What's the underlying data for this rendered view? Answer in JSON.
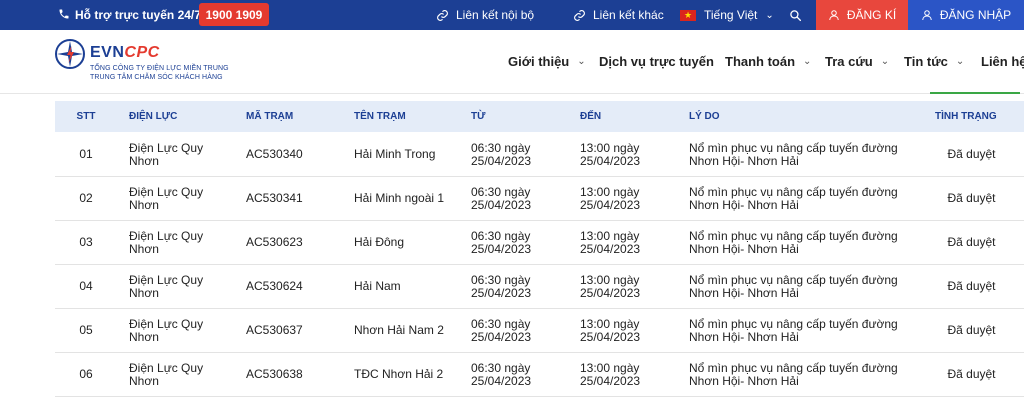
{
  "topbar": {
    "hotline_label": "Hỗ trợ trực tuyến 24/7:",
    "hotline_number": "1900 1909",
    "links": [
      {
        "label": "Liên kết nội bộ"
      },
      {
        "label": "Liên kết khác"
      }
    ],
    "language": "Tiếng Việt",
    "register_label": "ĐĂNG KÍ",
    "login_label": "ĐĂNG NHẬP"
  },
  "header": {
    "brand_evn": "EVN",
    "brand_cpc": "CPC",
    "sub1": "TỔNG CÔNG TY ĐIỆN LỰC MIỀN TRUNG",
    "sub2": "TRUNG TÂM CHĂM SÓC KHÁCH HÀNG",
    "nav": [
      {
        "label": "Giới thiệu"
      },
      {
        "label": "Dịch vụ trực tuyến"
      },
      {
        "label": "Thanh toán"
      },
      {
        "label": "Tra cứu"
      },
      {
        "label": "Tin tức"
      },
      {
        "label": "Liên hệ"
      }
    ]
  },
  "table": {
    "headers": [
      "STT",
      "ĐIỆN LỰC",
      "MÃ TRẠM",
      "TÊN TRẠM",
      "TỪ",
      "ĐẾN",
      "LÝ DO",
      "TÌNH TRẠNG"
    ],
    "rows": [
      [
        "01",
        "Điện Lực Quy Nhơn",
        "AC530340",
        "Hải Minh Trong",
        "06:30 ngày 25/04/2023",
        "13:00 ngày 25/04/2023",
        "Nổ mìn phục vụ nâng cấp tuyến đường Nhơn Hội- Nhơn Hải",
        "Đã duyệt"
      ],
      [
        "02",
        "Điện Lực Quy Nhơn",
        "AC530341",
        "Hải Minh ngoài 1",
        "06:30 ngày 25/04/2023",
        "13:00 ngày 25/04/2023",
        "Nổ mìn phục vụ nâng cấp tuyến đường Nhơn Hội- Nhơn Hải",
        "Đã duyệt"
      ],
      [
        "03",
        "Điện Lực Quy Nhơn",
        "AC530623",
        "Hải Đông",
        "06:30 ngày 25/04/2023",
        "13:00 ngày 25/04/2023",
        "Nổ mìn phục vụ nâng cấp tuyến đường Nhơn Hội- Nhơn Hải",
        "Đã duyệt"
      ],
      [
        "04",
        "Điện Lực Quy Nhơn",
        "AC530624",
        "Hải Nam",
        "06:30 ngày 25/04/2023",
        "13:00 ngày 25/04/2023",
        "Nổ mìn phục vụ nâng cấp tuyến đường Nhơn Hội- Nhơn Hải",
        "Đã duyệt"
      ],
      [
        "05",
        "Điện Lực Quy Nhơn",
        "AC530637",
        "Nhơn Hải Nam 2",
        "06:30 ngày 25/04/2023",
        "13:00 ngày 25/04/2023",
        "Nổ mìn phục vụ nâng cấp tuyến đường Nhơn Hội- Nhơn Hải",
        "Đã duyệt"
      ],
      [
        "06",
        "Điện Lực Quy Nhơn",
        "AC530638",
        "TĐC Nhơn Hải 2",
        "06:30 ngày 25/04/2023",
        "13:00 ngày 25/04/2023",
        "Nổ mìn phục vụ nâng cấp tuyến đường Nhơn Hội- Nhơn Hải",
        "Đã duyệt"
      ]
    ]
  },
  "colors": {
    "topbar": "#1c3f94",
    "hotline_badge": "#e43a2f",
    "register": "#e8473d",
    "login": "#2b55c6",
    "table_header_bg": "#e4ecf8",
    "header_text": "#1c3f94"
  },
  "icons": {
    "phone": "phone-icon",
    "link": "link-icon",
    "flag": "vietnam-flag-icon",
    "search": "search-icon",
    "user": "user-icon",
    "chevron": "chevron-down-icon"
  }
}
